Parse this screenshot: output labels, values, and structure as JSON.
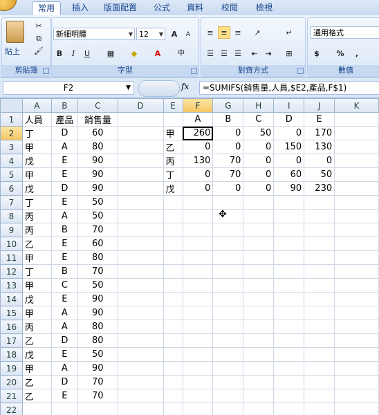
{
  "tabs": [
    "常用",
    "插入",
    "版面配置",
    "公式",
    "資料",
    "校閱",
    "檢視"
  ],
  "ribbon": {
    "clipboard": {
      "paste": "貼上",
      "label": "剪貼簿"
    },
    "font": {
      "name": "新細明體",
      "size": "12",
      "grow": "A",
      "shrink": "A",
      "bold": "B",
      "italic": "I",
      "underline": "U",
      "label": "字型"
    },
    "alignment": {
      "label": "對齊方式"
    },
    "number": {
      "format": "通用格式",
      "currency": "$",
      "percent": "%",
      "comma": ",",
      "label": "數值"
    }
  },
  "formula_bar": {
    "name_box": "F2",
    "fx": "fx",
    "formula": "=SUMIFS(銷售量,人員,$E2,產品,F$1)"
  },
  "columns": [
    "A",
    "B",
    "C",
    "D",
    "E",
    "F",
    "G",
    "H",
    "I",
    "J",
    "K"
  ],
  "active": {
    "col": "F",
    "row": 2
  },
  "rows": [
    [
      "人員",
      "產品",
      "銷售量",
      "",
      "",
      "A",
      "B",
      "C",
      "D",
      "E",
      ""
    ],
    [
      "丁",
      "D",
      "60",
      "",
      "甲",
      "260",
      "0",
      "50",
      "0",
      "170",
      ""
    ],
    [
      "甲",
      "A",
      "80",
      "",
      "乙",
      "0",
      "0",
      "0",
      "150",
      "130",
      ""
    ],
    [
      "戊",
      "E",
      "90",
      "",
      "丙",
      "130",
      "70",
      "0",
      "0",
      "0",
      ""
    ],
    [
      "甲",
      "E",
      "90",
      "",
      "丁",
      "0",
      "70",
      "0",
      "60",
      "50",
      ""
    ],
    [
      "戊",
      "D",
      "90",
      "",
      "戊",
      "0",
      "0",
      "0",
      "90",
      "230",
      ""
    ],
    [
      "丁",
      "E",
      "50",
      "",
      "",
      "",
      "",
      "",
      "",
      "",
      ""
    ],
    [
      "丙",
      "A",
      "50",
      "",
      "",
      "",
      "",
      "",
      "",
      "",
      ""
    ],
    [
      "丙",
      "B",
      "70",
      "",
      "",
      "",
      "",
      "",
      "",
      "",
      ""
    ],
    [
      "乙",
      "E",
      "60",
      "",
      "",
      "",
      "",
      "",
      "",
      "",
      ""
    ],
    [
      "甲",
      "E",
      "80",
      "",
      "",
      "",
      "",
      "",
      "",
      "",
      ""
    ],
    [
      "丁",
      "B",
      "70",
      "",
      "",
      "",
      "",
      "",
      "",
      "",
      ""
    ],
    [
      "甲",
      "C",
      "50",
      "",
      "",
      "",
      "",
      "",
      "",
      "",
      ""
    ],
    [
      "戊",
      "E",
      "90",
      "",
      "",
      "",
      "",
      "",
      "",
      "",
      ""
    ],
    [
      "甲",
      "A",
      "90",
      "",
      "",
      "",
      "",
      "",
      "",
      "",
      ""
    ],
    [
      "丙",
      "A",
      "80",
      "",
      "",
      "",
      "",
      "",
      "",
      "",
      ""
    ],
    [
      "乙",
      "D",
      "80",
      "",
      "",
      "",
      "",
      "",
      "",
      "",
      ""
    ],
    [
      "戊",
      "E",
      "50",
      "",
      "",
      "",
      "",
      "",
      "",
      "",
      ""
    ],
    [
      "甲",
      "A",
      "90",
      "",
      "",
      "",
      "",
      "",
      "",
      "",
      ""
    ],
    [
      "乙",
      "D",
      "70",
      "",
      "",
      "",
      "",
      "",
      "",
      "",
      ""
    ],
    [
      "乙",
      "E",
      "70",
      "",
      "",
      "",
      "",
      "",
      "",
      "",
      ""
    ],
    [
      "",
      "",
      "",
      "",
      "",
      "",
      "",
      "",
      "",
      "",
      ""
    ]
  ]
}
